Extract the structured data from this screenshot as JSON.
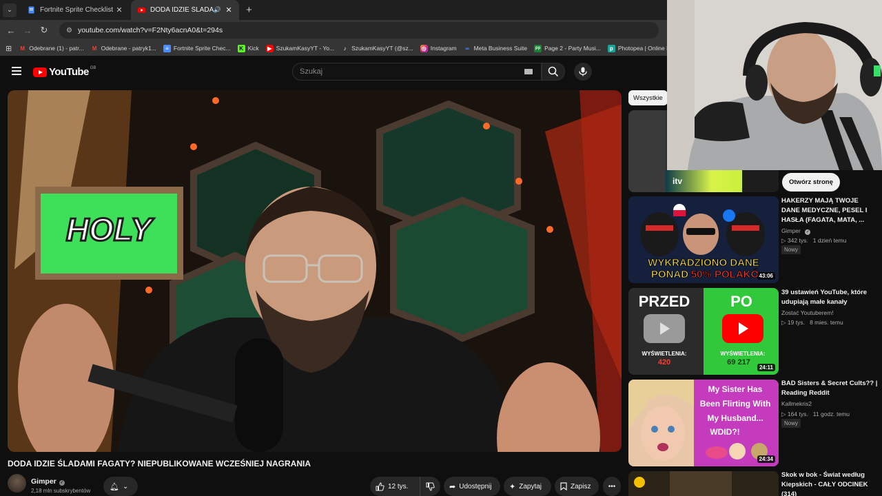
{
  "browser": {
    "tabs": [
      {
        "title": "Fortnite Sprite Checklist — Coll",
        "active": false
      },
      {
        "title": "DODA IDZIE ŚLADAMI FAG",
        "active": true
      }
    ],
    "url": "youtube.com/watch?v=F2Nty6acnA0&t=294s",
    "bookmarks": [
      {
        "label": "Odebrane (1) - patr...",
        "icon": "gmail-icon"
      },
      {
        "label": "Odebrane - patryk1...",
        "icon": "gmail-icon"
      },
      {
        "label": "Fortnite Sprite Chec...",
        "icon": "doc-icon"
      },
      {
        "label": "Kick",
        "icon": "kick-icon"
      },
      {
        "label": "SzukamKasyYT - Yo...",
        "icon": "youtube-icon"
      },
      {
        "label": "SzukamKasyYT (@sz...",
        "icon": "tiktok-icon"
      },
      {
        "label": "Instagram",
        "icon": "instagram-icon"
      },
      {
        "label": "Meta Business Suite",
        "icon": "meta-icon"
      },
      {
        "label": "Page 2 - Party Musi...",
        "icon": "pp-icon"
      },
      {
        "label": "Photopea | Online P...",
        "icon": "photopea-icon"
      }
    ]
  },
  "youtube": {
    "logo_text": "YouTube",
    "country_code": "GB",
    "search_placeholder": "Szukaj"
  },
  "video": {
    "title": "DODA IDZIE ŚLADAMI FAGATY? NIEPUBLIKOWANE WCZEŚNIEJ NAGRANIA",
    "channel": "Gimper",
    "subscribers": "2,18 mln subskrybentów",
    "likes": "12 tys.",
    "share_label": "Udostępnij",
    "ask_label": "Zapytaj",
    "save_label": "Zapisz",
    "sign_text": "HOLY"
  },
  "sidebar": {
    "chip_all": "Wszystkie",
    "ad_button": "Otwórz stronę",
    "ad_logo": "itv",
    "recommendations": [
      {
        "title_line1": "HAKERZY MAJĄ TWOJE",
        "title_line2": "DANE MEDYCZNE, PESEL I",
        "title_line3": "HASŁA (FAGATA, MATA, ...",
        "channel": "Gimper",
        "verified": true,
        "views": "342 tys.",
        "age": "1 dzień temu",
        "badge": "Nowy",
        "duration": "43:06",
        "thumb_text1": "WYKRADZIONO DANE",
        "thumb_text2": "PONAD",
        "thumb_text3": "50% POLAKÓ"
      },
      {
        "title_line1": "39 ustawień YouTube, które",
        "title_line2": "udupiają małe kanały",
        "channel": "Zostać Youtuberem!",
        "views": "19 tys.",
        "age": "8 mies. temu",
        "duration": "24:11",
        "thumb_left": "PRZED",
        "thumb_right": "PO",
        "thumb_left_label": "WYŚWIETLENIA:",
        "thumb_left_value": "420",
        "thumb_right_label": "WYŚWIETLENIA:",
        "thumb_right_value": "69 217"
      },
      {
        "title_line1": "BAD Sisters & Secret Cults?? |",
        "title_line2": "Reading Reddit",
        "channel": "Kallmekris2",
        "views": "164 tys.",
        "age": "11 godz. temu",
        "badge": "Nowy",
        "duration": "24:34",
        "thumb_line1": "My Sister Has",
        "thumb_line2": "Been Flirting With",
        "thumb_line3": "My Husband...",
        "thumb_line4": "WDID?!"
      },
      {
        "title_line1": "Skok w bok - Świat według",
        "title_line2": "Kiepskich - CAŁY ODCINEK",
        "title_line3": "(314)"
      }
    ]
  },
  "colors": {
    "background": "#0f0f0f",
    "brand_red": "#ff0000",
    "chip_bg": "#f1f1f1",
    "sign_green": "#3ee05a"
  }
}
